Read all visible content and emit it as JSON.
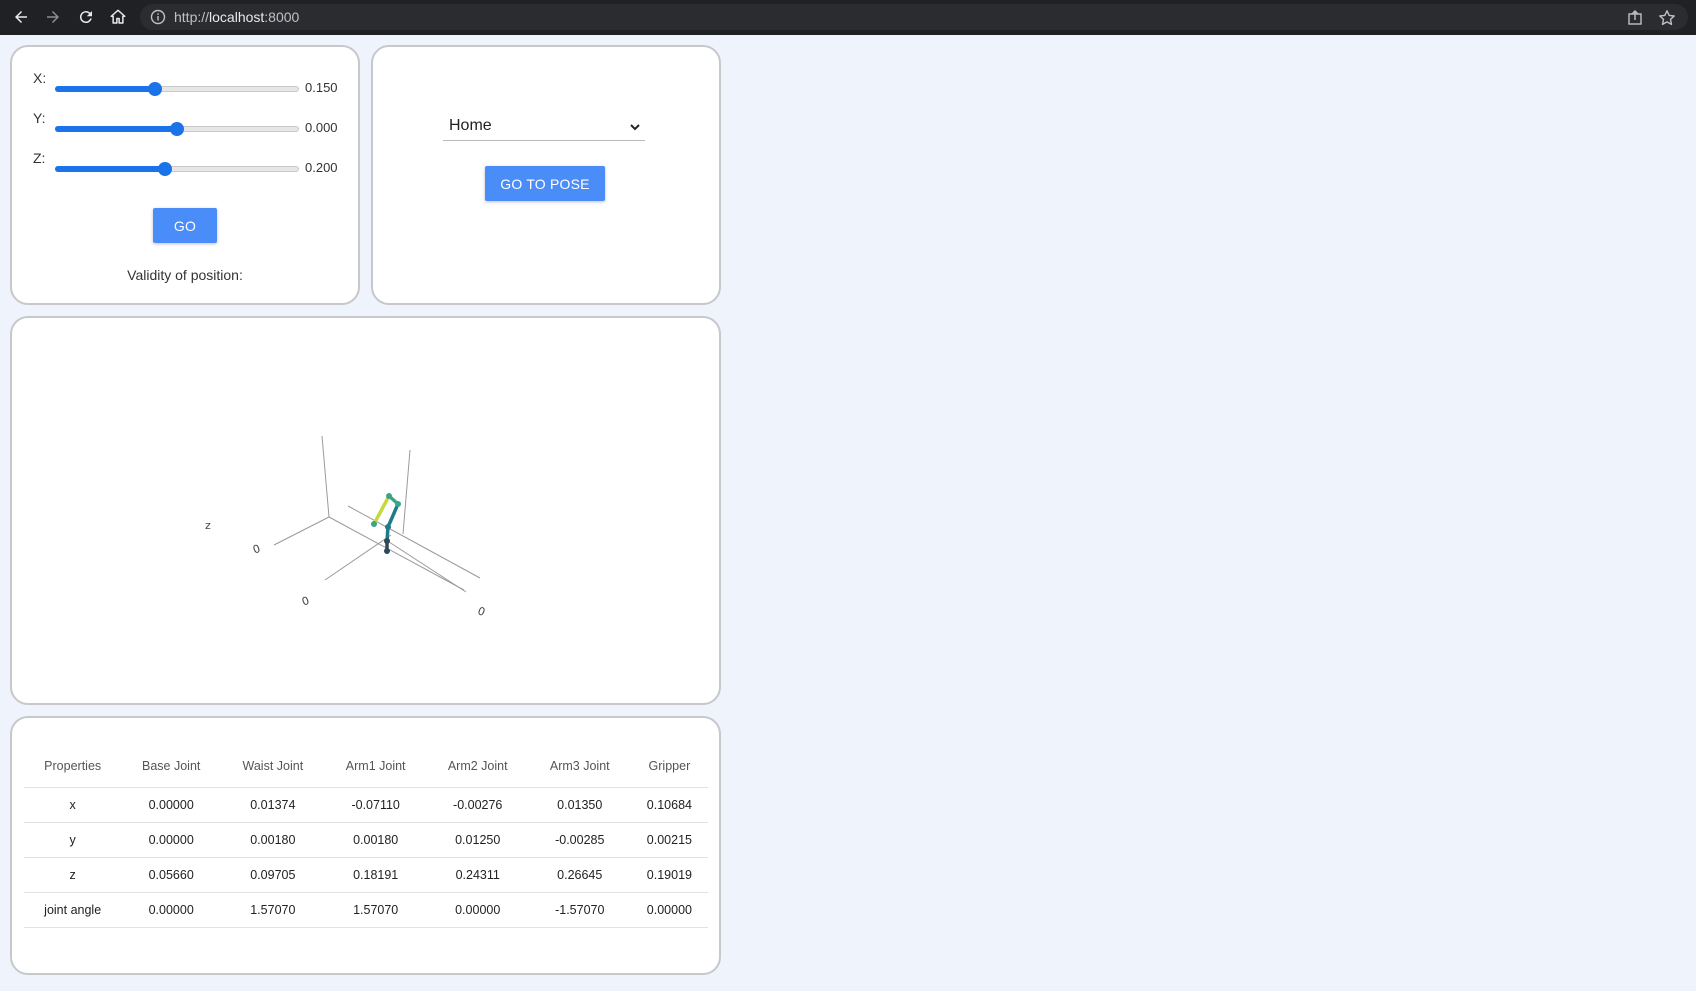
{
  "browser": {
    "url_scheme": "http://",
    "url_host": "localhost",
    "url_port": ":8000"
  },
  "position_panel": {
    "sliders": [
      {
        "label": "X:",
        "value_text": "0.150",
        "fill_fraction": 0.41
      },
      {
        "label": "Y:",
        "value_text": "0.000",
        "fill_fraction": 0.5
      },
      {
        "label": "Z:",
        "value_text": "0.200",
        "fill_fraction": 0.45
      }
    ],
    "go_label": "GO",
    "validity_label": "Validity of position:"
  },
  "pose_panel": {
    "selected_pose": "Home",
    "go_to_pose_label": "GO TO POSE"
  },
  "plot": {
    "axis_title_z": "z",
    "tick_labels": [
      "0",
      "0",
      "0"
    ],
    "arm_colors": [
      "#2e4a5a",
      "#1f7a8c",
      "#3ba58a",
      "#c7d83f"
    ]
  },
  "joint_table": {
    "headers": [
      "Properties",
      "Base Joint",
      "Waist Joint",
      "Arm1 Joint",
      "Arm2 Joint",
      "Arm3 Joint",
      "Gripper"
    ],
    "rows": [
      [
        "x",
        "0.00000",
        "0.01374",
        "-0.07110",
        "-0.00276",
        "0.01350",
        "0.10684"
      ],
      [
        "y",
        "0.00000",
        "0.00180",
        "0.00180",
        "0.01250",
        "-0.00285",
        "0.00215"
      ],
      [
        "z",
        "0.05660",
        "0.09705",
        "0.18191",
        "0.24311",
        "0.26645",
        "0.19019"
      ],
      [
        "joint angle",
        "0.00000",
        "1.57070",
        "1.57070",
        "0.00000",
        "-1.57070",
        "0.00000"
      ]
    ]
  }
}
